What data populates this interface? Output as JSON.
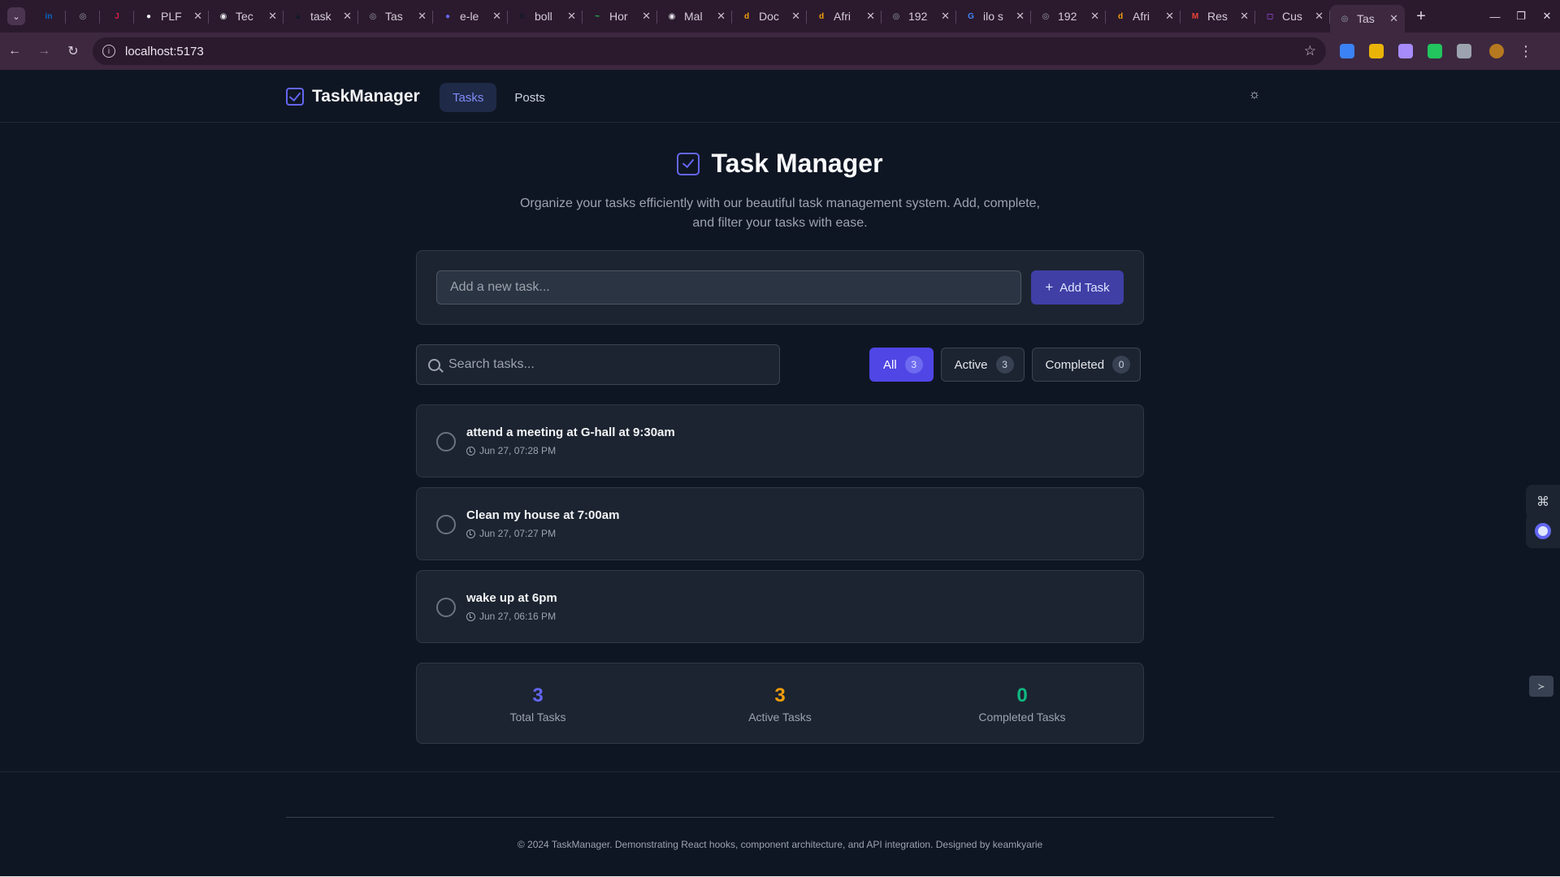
{
  "browser": {
    "tabs": [
      {
        "title": "",
        "favicon_color": "#0a66c2",
        "favicon_glyph": "in",
        "pinned": true
      },
      {
        "title": "",
        "favicon_color": "#9ca3af",
        "favicon_glyph": "◎",
        "pinned": true
      },
      {
        "title": "",
        "favicon_color": "#e11d48",
        "favicon_glyph": "J",
        "pinned": true
      },
      {
        "title": "PLF",
        "favicon_color": "#f3f4f6",
        "favicon_glyph": "●"
      },
      {
        "title": "Tec",
        "favicon_color": "#e5e7eb",
        "favicon_glyph": "◉"
      },
      {
        "title": "task",
        "favicon_color": "#111827",
        "favicon_glyph": "▲"
      },
      {
        "title": "Tas",
        "favicon_color": "#9ca3af",
        "favicon_glyph": "◎"
      },
      {
        "title": "e-le",
        "favicon_color": "#6366f1",
        "favicon_glyph": "●"
      },
      {
        "title": "boll",
        "favicon_color": "#111827",
        "favicon_glyph": "b"
      },
      {
        "title": "Hor",
        "favicon_color": "#22c55e",
        "favicon_glyph": "~"
      },
      {
        "title": "Mal",
        "favicon_color": "#e5e7eb",
        "favicon_glyph": "◉"
      },
      {
        "title": "Doc",
        "favicon_color": "#f59e0b",
        "favicon_glyph": "d"
      },
      {
        "title": "Afri",
        "favicon_color": "#f59e0b",
        "favicon_glyph": "d"
      },
      {
        "title": "192",
        "favicon_color": "#9ca3af",
        "favicon_glyph": "◎"
      },
      {
        "title": "ilo s",
        "favicon_color": "#4285f4",
        "favicon_glyph": "G"
      },
      {
        "title": "192",
        "favicon_color": "#9ca3af",
        "favicon_glyph": "◎"
      },
      {
        "title": "Afri",
        "favicon_color": "#f59e0b",
        "favicon_glyph": "d"
      },
      {
        "title": "Res",
        "favicon_color": "#ea4335",
        "favicon_glyph": "M"
      },
      {
        "title": "Cus",
        "favicon_color": "#a855f7",
        "favicon_glyph": "◻"
      },
      {
        "title": "Tas",
        "favicon_color": "#9ca3af",
        "favicon_glyph": "◎",
        "active": true
      }
    ],
    "new_tab": "+",
    "url": "localhost:5173",
    "extension_colors": [
      "#3b82f6",
      "#eab308",
      "#a78bfa",
      "#22c55e",
      "#9ca3af"
    ]
  },
  "app": {
    "brand": "TaskManager",
    "nav": [
      {
        "label": "Tasks",
        "active": true
      },
      {
        "label": "Posts",
        "active": false
      }
    ],
    "theme_toggle_icon": "sun-icon",
    "accent": "#6366f1"
  },
  "hero": {
    "title": "Task Manager",
    "subtitle": "Organize your tasks efficiently with our beautiful task management system. Add, complete, and filter your tasks with ease."
  },
  "add_task": {
    "placeholder": "Add a new task...",
    "button_label": "Add Task"
  },
  "search": {
    "placeholder": "Search tasks..."
  },
  "filters": [
    {
      "label": "All",
      "count": "3",
      "active": true
    },
    {
      "label": "Active",
      "count": "3",
      "active": false
    },
    {
      "label": "Completed",
      "count": "0",
      "active": false
    }
  ],
  "tasks": [
    {
      "title": "attend a meeting at G-hall at 9:30am",
      "date": "Jun 27, 07:28 PM",
      "completed": false
    },
    {
      "title": "Clean my house at 7:00am",
      "date": "Jun 27, 07:27 PM",
      "completed": false
    },
    {
      "title": "wake up at 6pm",
      "date": "Jun 27, 06:16 PM",
      "completed": false
    }
  ],
  "stats": [
    {
      "value": "3",
      "label": "Total Tasks",
      "color": "#6366f1"
    },
    {
      "value": "3",
      "label": "Active Tasks",
      "color": "#f59e0b"
    },
    {
      "value": "0",
      "label": "Completed Tasks",
      "color": "#10b981"
    }
  ],
  "footer": {
    "text": "© 2024 TaskManager. Demonstrating React hooks, component architecture, and API integration. Designed by keamkyarie"
  }
}
